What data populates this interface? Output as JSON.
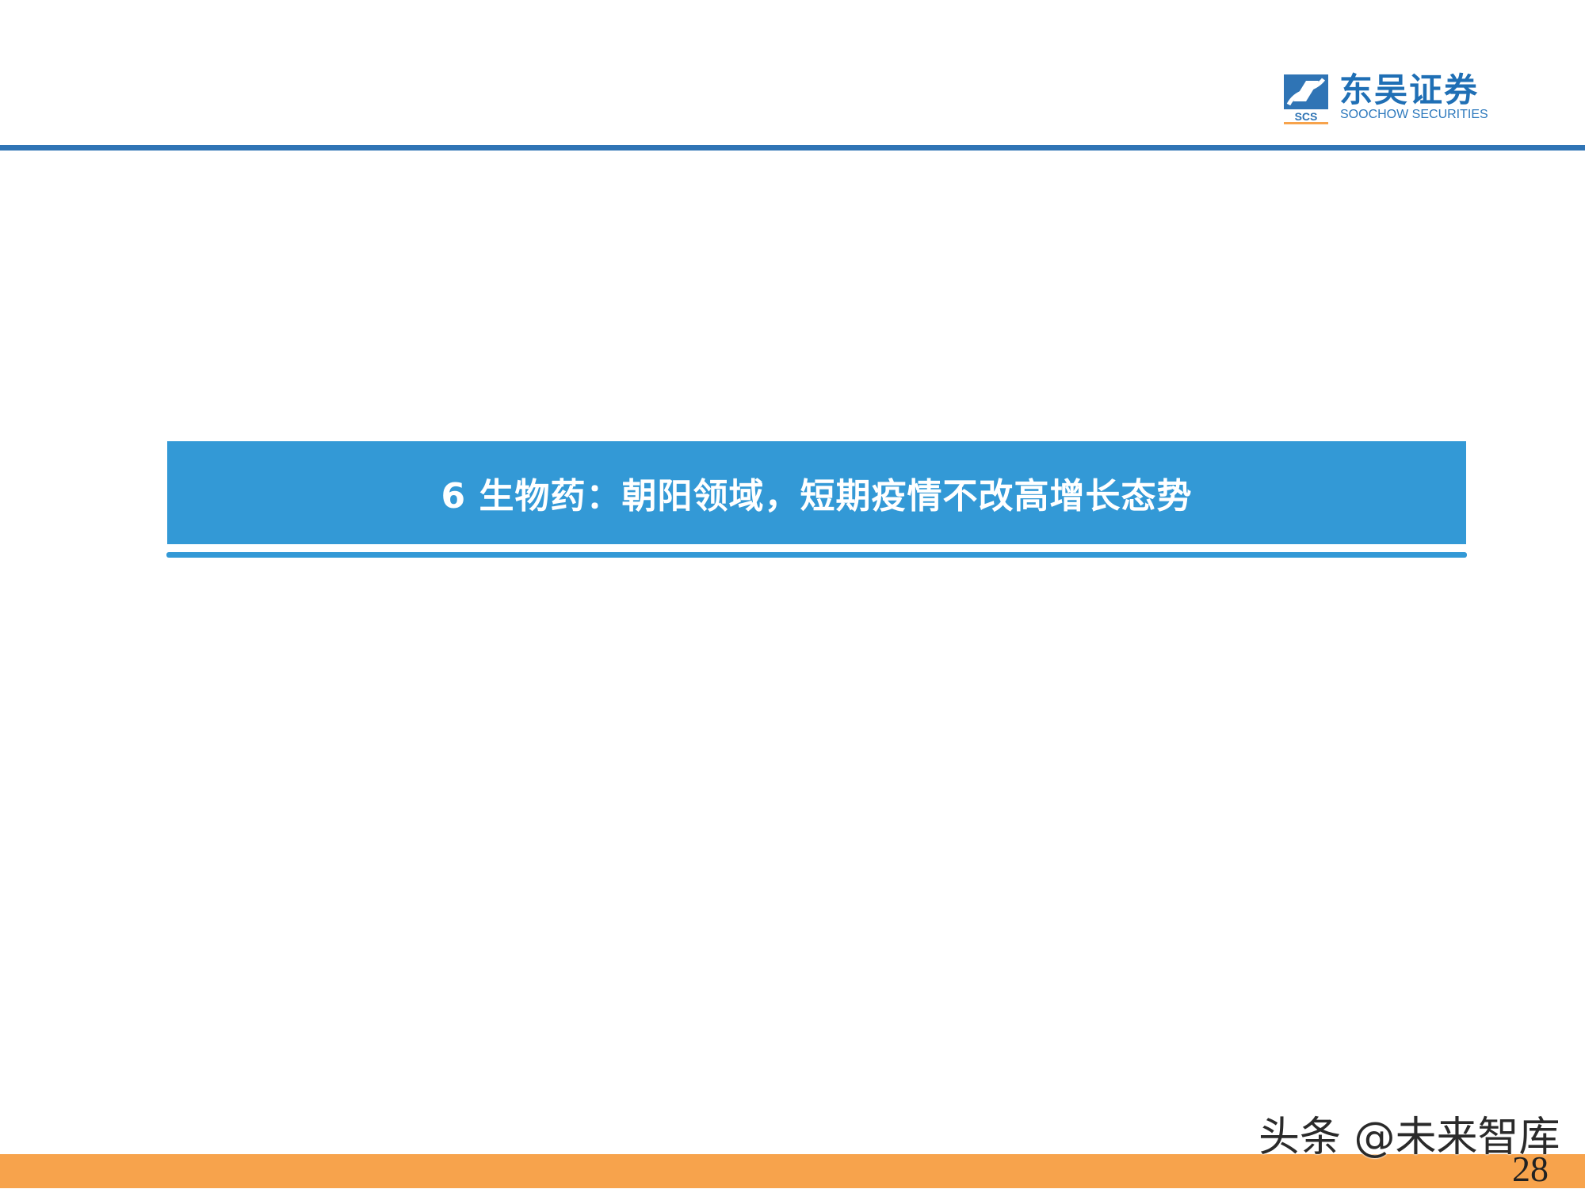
{
  "header": {
    "logo_cn": "东吴证券",
    "logo_en": "SOOCHOW SECURITIES",
    "logo_abbr": "SCS",
    "brand_color": "#2f74b5"
  },
  "section": {
    "title": "6 生物药：朝阳领域，短期疫情不改高增长态势",
    "banner_color": "#3399d6"
  },
  "footer": {
    "watermark": "头条 @未来智库",
    "page_number": "28",
    "bar_color": "#f7a34c"
  }
}
